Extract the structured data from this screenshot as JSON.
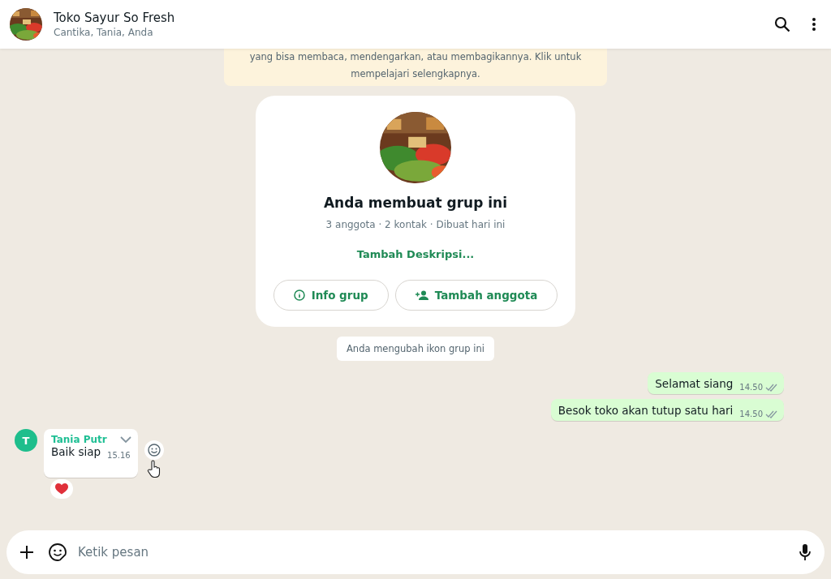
{
  "header": {
    "title": "Toko Sayur So Fresh",
    "subtitle": "Cantika, Tania, Anda"
  },
  "notice": "yang bisa membaca, mendengarkan, atau membagikannya. Klik untuk mempelajari selengkapnya.",
  "group_card": {
    "title": "Anda membuat grup ini",
    "meta": "3 anggota · 2 kontak · Dibuat hari ini",
    "description_link": "Tambah Deskripsi...",
    "buttons": [
      {
        "kind": "info",
        "label": "Info grup"
      },
      {
        "kind": "add",
        "label": "Tambah anggota"
      }
    ]
  },
  "system_message": "Anda mengubah ikon grup ini",
  "messages": [
    {
      "kind": "outgoing",
      "text": "Selamat siang",
      "time": "14.50",
      "read": false
    },
    {
      "kind": "outgoing",
      "text": "Besok toko akan tutup satu hari",
      "time": "14.50",
      "read": false
    },
    {
      "kind": "incoming",
      "sender": "Tania Putr",
      "avatar": "T",
      "text": "Baik siap",
      "time": "15.16",
      "reacted": true
    }
  ],
  "composer": {
    "placeholder": "Ketik pesan"
  }
}
